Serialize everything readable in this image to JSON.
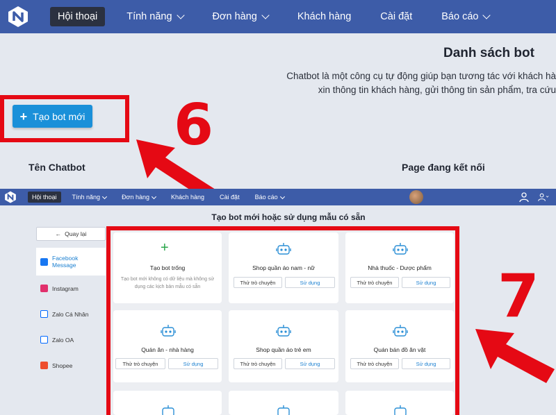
{
  "nav": {
    "items": [
      {
        "label": "Hội thoại",
        "active": true,
        "dropdown": false
      },
      {
        "label": "Tính năng",
        "active": false,
        "dropdown": true
      },
      {
        "label": "Đơn hàng",
        "active": false,
        "dropdown": true
      },
      {
        "label": "Khách hàng",
        "active": false,
        "dropdown": false
      },
      {
        "label": "Cài đặt",
        "active": false,
        "dropdown": false
      },
      {
        "label": "Báo cáo",
        "active": false,
        "dropdown": true
      }
    ]
  },
  "page": {
    "title": "Danh sách bot",
    "description_line1": "Chatbot là một công cụ tự động giúp bạn tương tác với khách hà",
    "description_line2": "xin thông tin khách hàng, gửi thông tin sản phẩm, tra cứu",
    "create_button": "Tạo bot mới",
    "col_name": "Tên Chatbot",
    "col_page": "Page đang kết nối"
  },
  "annotations": {
    "step1": "6",
    "step2": "7",
    "color": "#e50914"
  },
  "modal": {
    "title": "Tạo bot mới hoặc sử dụng mẫu có sẵn",
    "back_button": "Quay lại",
    "channels": [
      {
        "label_line1": "Facebook",
        "label_line2": "Message",
        "icon": "facebook-icon",
        "color": "#1877f2",
        "active": true
      },
      {
        "label_line1": "Instagram",
        "label_line2": "",
        "icon": "instagram-icon",
        "color": "#e1306c",
        "active": false
      },
      {
        "label_line1": "Zalo Cá Nhân",
        "label_line2": "",
        "icon": "zalo-icon",
        "color": "#0068ff",
        "active": false
      },
      {
        "label_line1": "Zalo OA",
        "label_line2": "",
        "icon": "zalo-oa-icon",
        "color": "#0068ff",
        "active": false
      },
      {
        "label_line1": "Shopee",
        "label_line2": "",
        "icon": "shopee-icon",
        "color": "#ee4d2d",
        "active": false
      }
    ],
    "blank_card": {
      "title": "Tạo bot trống",
      "description": "Tạo bot mới không có dữ liệu mà không sử dụng các kịch bản mẫu có sẵn"
    },
    "templates": [
      {
        "title": "Shop quần áo nam - nữ"
      },
      {
        "title": "Nhà thuốc - Dược phẩm"
      },
      {
        "title": "Quán ăn - nhà hàng"
      },
      {
        "title": "Shop quần áo trẻ em"
      },
      {
        "title": "Quán bán đồ ăn vặt"
      }
    ],
    "try_label": "Thử trò chuyện",
    "use_label": "Sử dụng"
  }
}
